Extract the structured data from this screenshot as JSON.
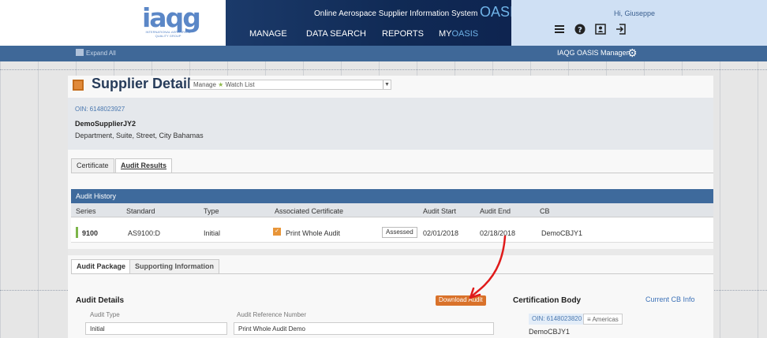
{
  "header": {
    "logo_text": "iaqg",
    "logo_tagline": "INTERNATIONAL AEROSPACE QUALITY GROUP",
    "system_title": "Online Aerospace Supplier Information System",
    "system_brand": "OASIS",
    "nav": [
      {
        "label": "MANAGE"
      },
      {
        "label": "DATA SEARCH"
      },
      {
        "label": "REPORTS"
      },
      {
        "label_prefix": "MY",
        "label_suffix": "OASIS"
      }
    ],
    "greeting": "Hi, Giuseppe",
    "tools": {
      "menu_icon": "menu-icon",
      "help_icon": "help-icon",
      "profile_icon": "profile-icon",
      "logout_icon": "logout-icon"
    }
  },
  "subbar": {
    "expand_label": "Expand All",
    "manager_label": "IAQG OASIS Manager",
    "gear_icon": "gear-icon"
  },
  "supplier": {
    "title": "Supplier Details",
    "watch_manage": "Manage",
    "watch_label": "Watch List",
    "oin": "OIN: 6148023927",
    "name": "DemoSupplierJY2",
    "address": "Department, Suite, Street, City Bahamas"
  },
  "tabs": [
    {
      "label": "Certificate",
      "active": false
    },
    {
      "label": "Audit Results",
      "active": true
    }
  ],
  "audit_history": {
    "title": "Audit History",
    "columns": [
      "Series",
      "Standard",
      "Type",
      "Associated Certificate",
      "Audit Start",
      "Audit End",
      "CB"
    ],
    "row": {
      "series": "9100",
      "standard": "AS9100:D",
      "type": "Initial",
      "certificate": "Print Whole Audit",
      "status": "Assessed",
      "audit_start": "02/01/2018",
      "audit_end": "02/18/2018",
      "cb": "DemoCBJY1"
    }
  },
  "package_tabs": [
    {
      "label": "Audit Package",
      "active": true
    },
    {
      "label": "Supporting Information",
      "active": false
    }
  ],
  "audit_details": {
    "title": "Audit Details",
    "type_label": "Audit Type",
    "type_value": "Initial",
    "ref_label": "Audit Reference Number",
    "ref_value": "Print Whole Audit Demo",
    "download_label": "Download Audit"
  },
  "certification_body": {
    "title": "Certification Body",
    "link_label": "Current CB Info",
    "oin": "OIN: 6148023820",
    "region": "Americas",
    "name": "DemoCBJY1"
  },
  "colors": {
    "nav_bg": "#102a55",
    "subbar_bg": "#3f6898",
    "accent_orange": "#d9722a",
    "annotation_red": "#e01b1b"
  }
}
